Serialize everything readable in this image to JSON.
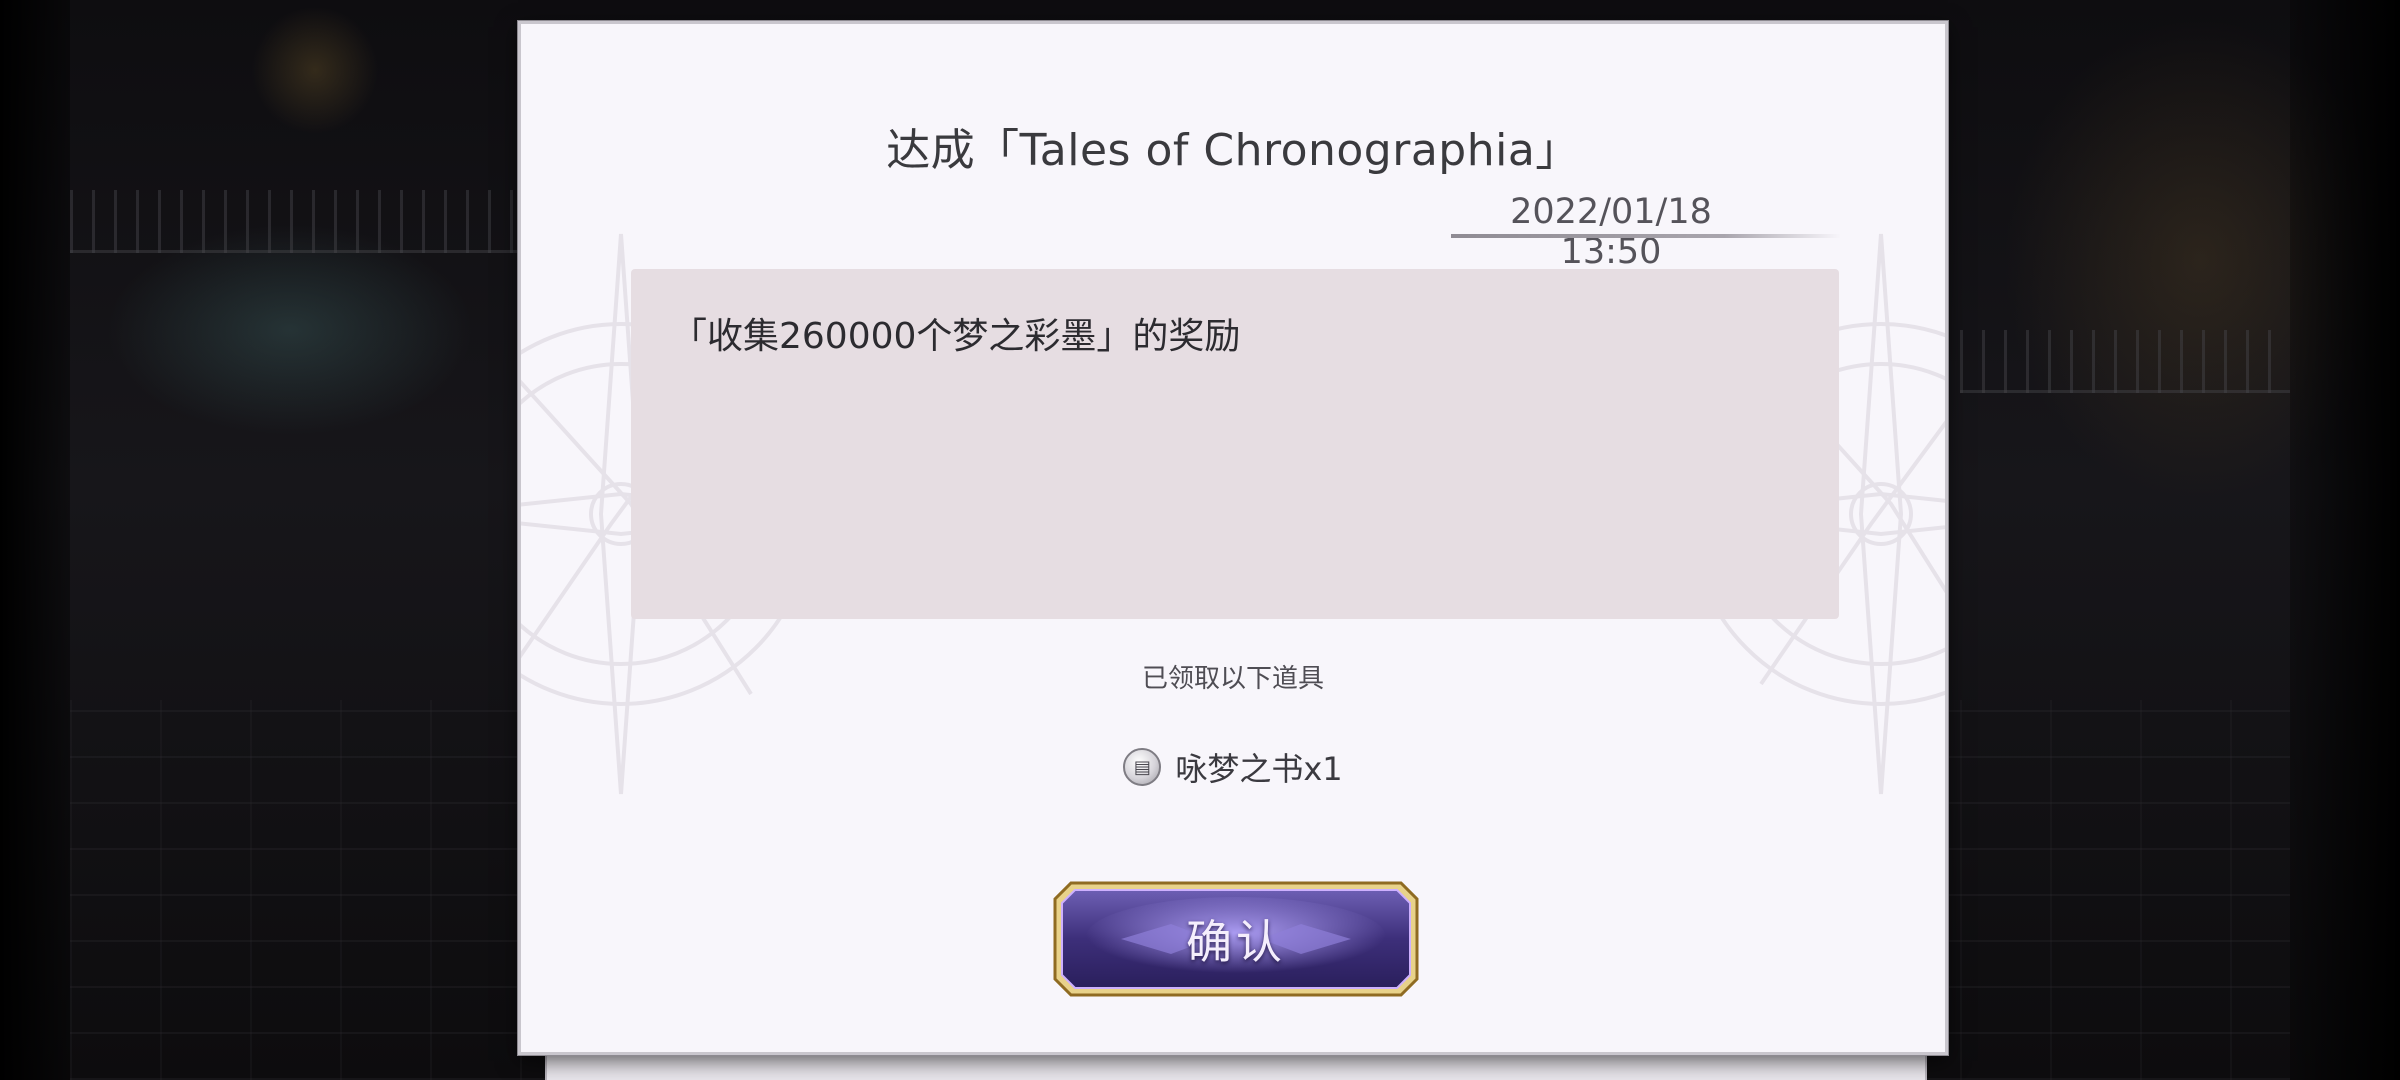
{
  "dialog": {
    "title": "达成「Tales of Chronographia」",
    "date": "2022/01/18 13:50",
    "message": "「收集260000个梦之彩墨」的奖励",
    "received_label": "已领取以下道具",
    "reward": {
      "icon": "book-icon",
      "text": "咏梦之书x1"
    },
    "confirm_label": "确认"
  },
  "colors": {
    "dialog_bg": "#f8f6fb",
    "message_bg": "#e6dde2",
    "button_fill": "#3d2f7a",
    "button_border": "#c9a34c"
  }
}
